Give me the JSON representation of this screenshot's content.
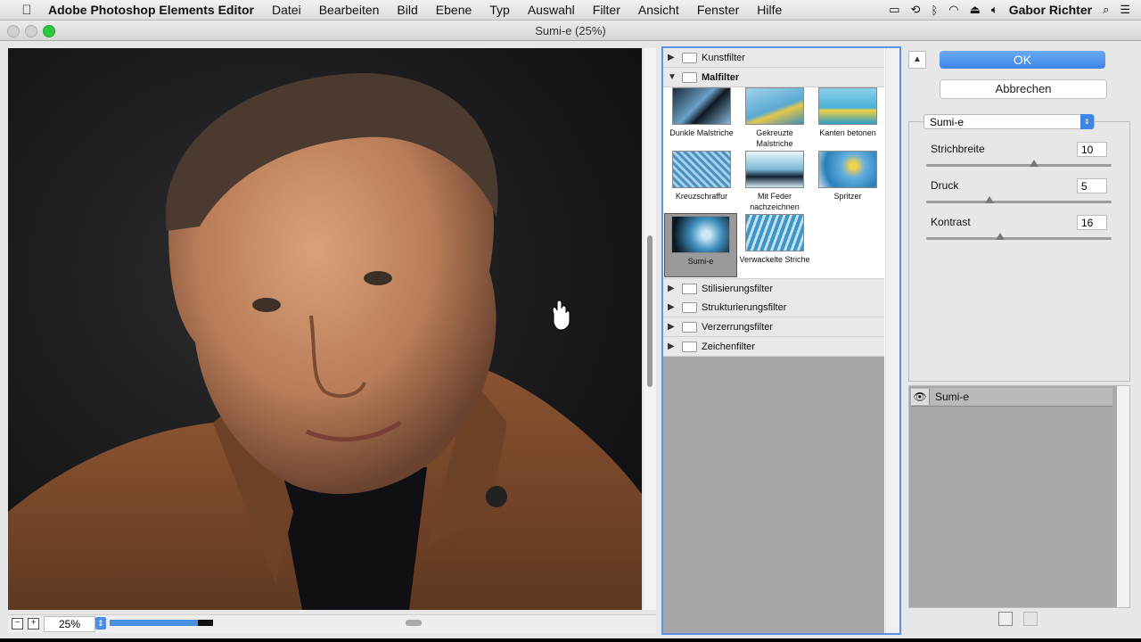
{
  "menubar": {
    "app_name": "Adobe Photoshop Elements Editor",
    "items": [
      "Datei",
      "Bearbeiten",
      "Bild",
      "Ebene",
      "Typ",
      "Auswahl",
      "Filter",
      "Ansicht",
      "Fenster",
      "Hilfe"
    ],
    "user": "Gabor Richter"
  },
  "window": {
    "title": "Sumi-e (25%)"
  },
  "status": {
    "zoom": "25%",
    "progress_fraction": 0.85
  },
  "filter_browser": {
    "categories_top": [
      {
        "label": "Kunstfilter",
        "expanded": false
      },
      {
        "label": "Malfilter",
        "expanded": true
      }
    ],
    "thumbnails": [
      {
        "label": "Dunkle Malstriche",
        "selected": false
      },
      {
        "label": "Gekreuzte Malstriche",
        "selected": false
      },
      {
        "label": "Kanten betonen",
        "selected": false
      },
      {
        "label": "Kreuzschraffur",
        "selected": false
      },
      {
        "label": "Mit Feder nachzeichnen",
        "selected": false
      },
      {
        "label": "Spritzer",
        "selected": false
      },
      {
        "label": "Sumi-e",
        "selected": true
      },
      {
        "label": "Verwackelte Striche",
        "selected": false
      }
    ],
    "categories_bottom": [
      {
        "label": "Stilisierungsfilter"
      },
      {
        "label": "Strukturierungsfilter"
      },
      {
        "label": "Verzerrungsfilter"
      },
      {
        "label": "Zeichenfilter"
      }
    ]
  },
  "settings": {
    "ok_label": "OK",
    "cancel_label": "Abbrechen",
    "selected_filter": "Sumi-e",
    "params": [
      {
        "label": "Strichbreite",
        "value": "10",
        "fraction": 0.58
      },
      {
        "label": "Druck",
        "value": "5",
        "fraction": 0.34
      },
      {
        "label": "Kontrast",
        "value": "16",
        "fraction": 0.4
      }
    ],
    "layer_name": "Sumi-e"
  },
  "colors": {
    "accent": "#3d86e6",
    "selection_border": "#5a93e6"
  }
}
